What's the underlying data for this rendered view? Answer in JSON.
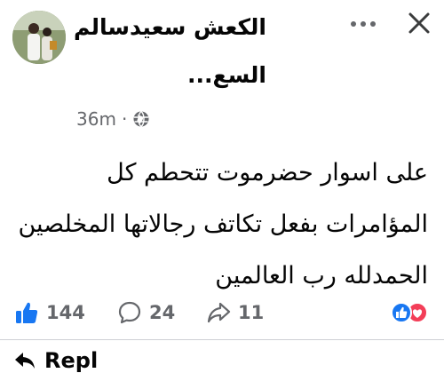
{
  "post": {
    "author_name_line1": "الكعش سعيدسالم",
    "author_name_line2": "السع...",
    "timestamp": "36m",
    "separator": "·",
    "privacy_icon": "globe-icon",
    "body_lines": [
      "على اسوار حضرموت تتحطم كل",
      "المؤامرات بفعل تكاتف رجالاتها المخلصين",
      "الحمدلله رب العالمين"
    ]
  },
  "header_actions": {
    "more_icon": "more-horizontal-icon",
    "close_icon": "close-icon"
  },
  "actions": {
    "likes": "144",
    "comments": "24",
    "shares": "11"
  },
  "footer": {
    "reply_label": "Repl"
  },
  "colors": {
    "accent_blue": "#1877f2",
    "love_red": "#f33e58",
    "meta_grey": "#65676b",
    "text": "#050505"
  }
}
